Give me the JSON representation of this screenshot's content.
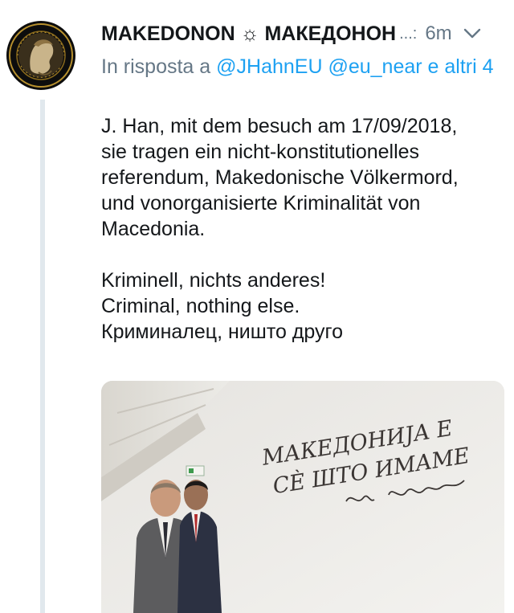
{
  "tweet": {
    "author_name": "MAKEDONON ☼ МАКЕДОНОН",
    "name_overflow": "...:",
    "timestamp": "6m",
    "reply_prefix": "In risposta a ",
    "reply_mentions": [
      "@JHahnEU",
      "@eu_near"
    ],
    "reply_suffix": " e altri 4",
    "text_lines_1": [
      "J. Han, mit dem besuch am 17/09/2018,",
      "sie tragen ein nicht-konstitutionelles",
      "referendum, Makedonische Völkermord,",
      "und vonorganisierte Kriminalität von",
      "Macedonia."
    ],
    "text_lines_2": [
      "Kriminell, nichts anderes!",
      "Criminal, nothing else.",
      "Криминалец, ништо друго"
    ],
    "media": {
      "wall_text_line1": "МАКЕДОНИЈА Е",
      "wall_text_line2": "СÈ ШТО ИМАМЕ"
    }
  },
  "icons": {
    "menu": "chevron-down-icon",
    "avatar": "coin-portrait-avatar",
    "exit_sign": "exit-sign-icon"
  },
  "colors": {
    "link": "#1da1f2",
    "muted": "#657786",
    "text": "#14171a",
    "thread_line": "#e1e8ed"
  }
}
